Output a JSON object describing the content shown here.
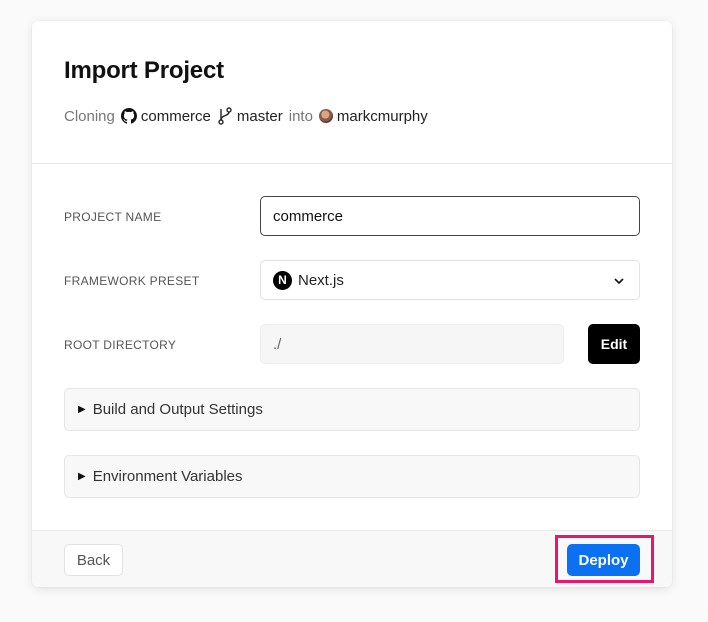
{
  "header": {
    "title": "Import Project",
    "cloning_prefix": "Cloning",
    "repo": "commerce",
    "branch": "master",
    "into_word": "into",
    "owner": "markcmurphy",
    "repo_icon": "github-icon",
    "branch_icon": "git-branch-icon"
  },
  "form": {
    "project_name": {
      "label": "PROJECT NAME",
      "value": "commerce"
    },
    "framework_preset": {
      "label": "FRAMEWORK PRESET",
      "value": "Next.js",
      "logo_letter": "N",
      "icon": "chevron-down-icon"
    },
    "root_directory": {
      "label": "ROOT DIRECTORY",
      "value": "./",
      "edit_label": "Edit"
    }
  },
  "sections": [
    {
      "label": "Build and Output Settings",
      "marker": "▶"
    },
    {
      "label": "Environment Variables",
      "marker": "▶"
    }
  ],
  "footer": {
    "back_label": "Back",
    "deploy_label": "Deploy"
  },
  "colors": {
    "deploy": "#0b70f2",
    "highlight": "#e8176b"
  }
}
